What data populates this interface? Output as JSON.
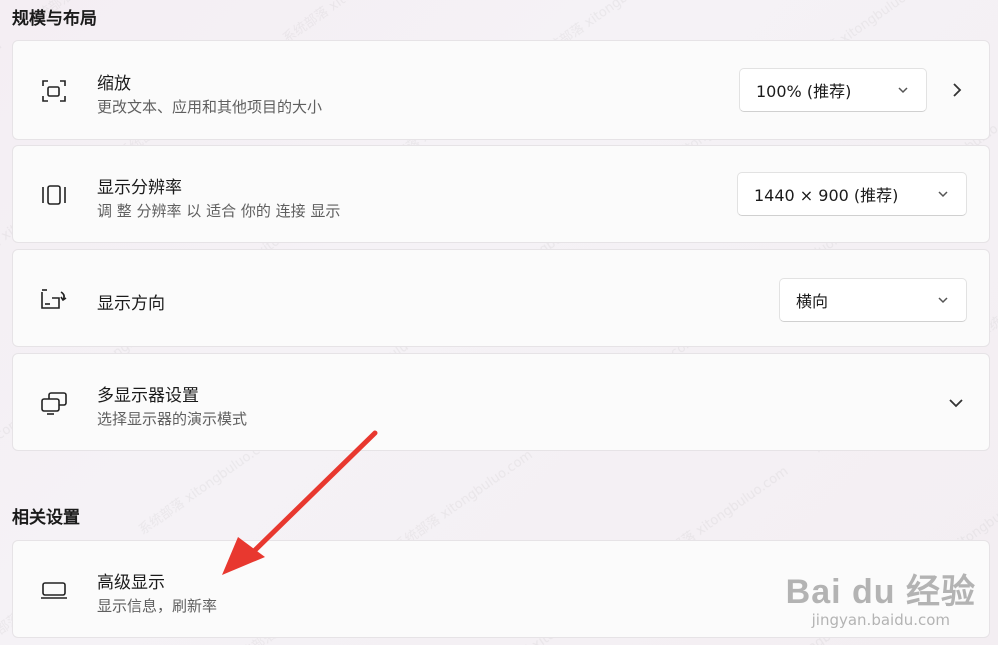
{
  "sections": {
    "scale_layout_title": "规模与布局",
    "related_title": "相关设置"
  },
  "scale": {
    "title": "缩放",
    "subtitle": "更改文本、应用和其他项目的大小",
    "value": "100% (推荐)"
  },
  "resolution": {
    "title": "显示分辨率",
    "subtitle": "调 整 分辨率 以 适合 你的 连接 显示",
    "value": "1440 × 900 (推荐)"
  },
  "orientation": {
    "title": "显示方向",
    "value": "横向"
  },
  "multi_display": {
    "title": "多显示器设置",
    "subtitle": "选择显示器的演示模式"
  },
  "advanced": {
    "title": "高级显示",
    "subtitle": "显示信息，刷新率"
  },
  "watermark": {
    "brand": "Bai du 经验",
    "url": "jingyan.baidu.com"
  },
  "colors": {
    "annotation_arrow": "#e8382f",
    "card_bg": "#fbfbfb"
  },
  "icons": {
    "scale": "resize-icon",
    "resolution": "resolution-icon",
    "orientation": "rotate-display-icon",
    "multi_display": "multi-monitor-icon",
    "advanced": "laptop-icon"
  }
}
